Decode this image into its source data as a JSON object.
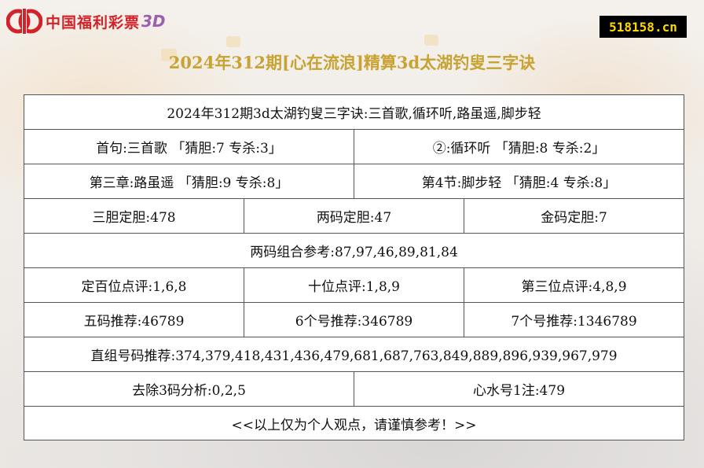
{
  "header": {
    "logo_text": "中国福利彩票",
    "logo_suffix": "3D",
    "site_badge": "518158.cn",
    "page_title": "2024年312期[心在流浪]精算3d太湖钓叟三字诀"
  },
  "rows": {
    "poem": "2024年312期3d太湖钓叟三字诀:三首歌,循环听,路虽遥,脚步轻",
    "line1": "首句:三首歌 「猜胆:7 专杀:3」",
    "line2": "②:循环听 「猜胆:8 专杀:2」",
    "line3": "第三章:路虽遥 「猜胆:9 专杀:8」",
    "line4": "第4节:脚步轻 「猜胆:4 专杀:8」",
    "three_dan": "三胆定胆:478",
    "two_dan": "两码定胆:47",
    "gold_dan": "金码定胆:7",
    "two_combo": "两码组合参考:87,97,46,89,81,84",
    "hundreds": "定百位点评:1,6,8",
    "tens": "十位点评:1,8,9",
    "units": "第三位点评:4,8,9",
    "five_codes": "五码推荐:46789",
    "six_codes": "6个号推荐:346789",
    "seven_codes": "7个号推荐:1346789",
    "direct_group": "直组号码推荐:374,379,418,431,436,479,681,687,763,849,889,896,939,967,979",
    "exclude": "去除3码分析:0,2,5",
    "heart_water": "心水号1注:479",
    "disclaimer": "<<以上仅为个人观点，请谨慎参考！>>"
  },
  "colors": {
    "logo_red": "#d3232a",
    "title_gold": "#c8a233",
    "badge_bg": "#000000",
    "badge_fg": "#ffd700"
  }
}
